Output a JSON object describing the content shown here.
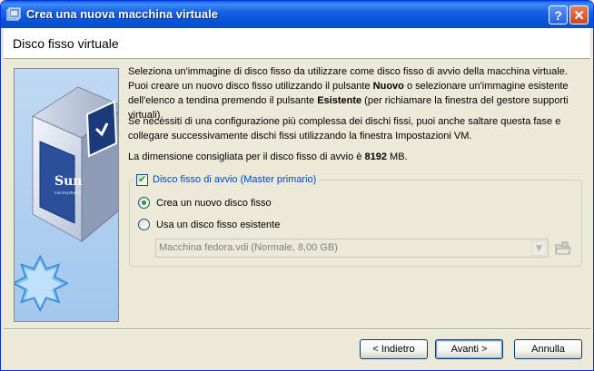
{
  "window": {
    "title": "Crea una nuova macchina virtuale",
    "help_label": "?",
    "close_label": "✕"
  },
  "header": {
    "title": "Disco fisso virtuale"
  },
  "sidebar": {
    "logo_text": "Sun",
    "logo_subtext": "microsystems"
  },
  "content": {
    "para1": {
      "a": "Seleziona un'immagine di disco fisso da utilizzare come disco fisso di avvio della macchina virtuale. Puoi creare un nuovo disco fisso utilizzando il pulsante ",
      "b": "Nuovo",
      "c": " o selezionare un'immagine esistente dell'elenco a tendina premendo il pulsante ",
      "d": "Esistente",
      "e": " (per richiamare la finestra del gestore supporti virtuali)."
    },
    "para2": "Se necessiti di una configurazione più complessa dei dischi fissi, puoi anche saltare questa fase e collegare successivamente dischi fissi utilizzando la finestra Impostazioni VM.",
    "para3": {
      "a": "La dimensione consigliata per il disco fisso di avvio è ",
      "b": "8192",
      "c": " MB."
    }
  },
  "boot_disk": {
    "checkbox_label": "Disco fisso di avvio (Master primario)",
    "checked": true,
    "options": [
      {
        "label": "Crea un nuovo disco fisso",
        "selected": true
      },
      {
        "label": "Usa un disco fisso esistente",
        "selected": false
      }
    ],
    "combo_value": "Macchina fedora.vdi (Normale, 8,00 GB)",
    "combo_arrow": "▼"
  },
  "buttons": {
    "back": "< Indietro",
    "next": "Avanti >",
    "cancel": "Annulla"
  },
  "colors": {
    "titlebar": "#0a5fe8",
    "dialog_bg": "#ece9d8",
    "legend_text": "#0046d5",
    "radio_check": "#21a121"
  }
}
